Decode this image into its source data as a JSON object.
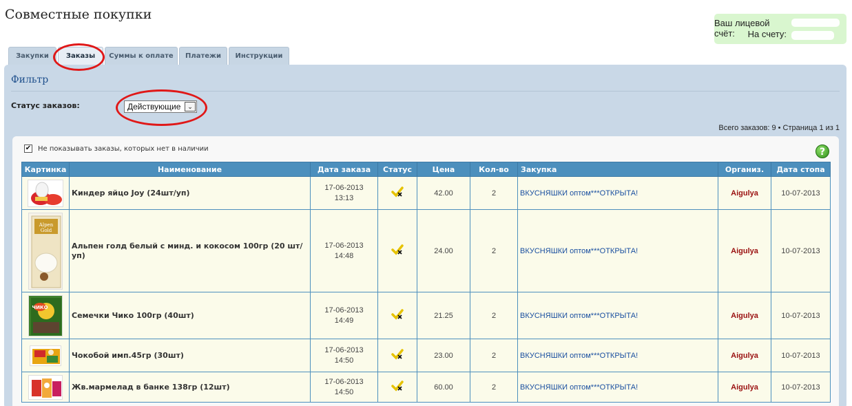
{
  "page": {
    "title": "Совместные покупки"
  },
  "account": {
    "line1": "Ваш лицевой счёт:",
    "line2": "На счету:"
  },
  "tabs": [
    {
      "label": "Закупки",
      "active": false
    },
    {
      "label": "Заказы",
      "active": true
    },
    {
      "label": "Суммы к оплате",
      "active": false
    },
    {
      "label": "Платежи",
      "active": false
    },
    {
      "label": "Инструкции",
      "active": false
    }
  ],
  "filter": {
    "title": "Фильтр",
    "status_label": "Статус заказов:",
    "status_value": "Действующие",
    "totals": "Всего заказов: 9 • Страница 1 из 1"
  },
  "options": {
    "hide_unavailable_label": "Не показывать заказы, которых нет в наличии",
    "hide_unavailable_checked": true
  },
  "help": {
    "icon": "help-icon",
    "symbol": "?"
  },
  "colors": {
    "header_blue": "#4c8fbd",
    "panel_bg": "#c9d8e7",
    "row_bg": "#fbfbea",
    "org_red": "#9a1010",
    "link_blue": "#1a4fa0",
    "annotation_red": "#e01818"
  },
  "table": {
    "columns": [
      "Картинка",
      "Наименование",
      "Дата заказа",
      "Статус",
      "Цена",
      "Кол-во",
      "Закупка",
      "Организ.",
      "Дата стопа"
    ],
    "rows": [
      {
        "image": "kinder-joy-thumbnail",
        "name": "Киндер яйцо Joy (24шт/уп)",
        "date": "17-06-2013",
        "time": "13:13",
        "status_icon": "check-x-icon",
        "price": "42.00",
        "qty": "2",
        "purchase": "ВКУСНЯШКИ оптом***ОТКРЫТА!",
        "org": "Aigulya",
        "stop": "10-07-2013"
      },
      {
        "image": "alpen-gold-thumbnail",
        "name": "Альпен голд белый с минд. и кокосом 100гр (20 шт/уп)",
        "date": "17-06-2013",
        "time": "14:48",
        "status_icon": "check-x-icon",
        "price": "24.00",
        "qty": "2",
        "purchase": "ВКУСНЯШКИ оптом***ОТКРЫТА!",
        "org": "Aigulya",
        "stop": "10-07-2013"
      },
      {
        "image": "chiko-seeds-thumbnail",
        "name": "Семечки Чико 100гр (40шт)",
        "date": "17-06-2013",
        "time": "14:49",
        "status_icon": "check-x-icon",
        "price": "21.25",
        "qty": "2",
        "purchase": "ВКУСНЯШКИ оптом***ОТКРЫТА!",
        "org": "Aigulya",
        "stop": "10-07-2013"
      },
      {
        "image": "chokoboy-thumbnail",
        "name": "Чокобой имп.45гр (30шт)",
        "date": "17-06-2013",
        "time": "14:50",
        "status_icon": "check-x-icon",
        "price": "23.00",
        "qty": "2",
        "purchase": "ВКУСНЯШКИ оптом***ОТКРЫТА!",
        "org": "Aigulya",
        "stop": "10-07-2013"
      },
      {
        "image": "marmalade-thumbnail",
        "name": "Жв.мармелад в банке 138гр (12шт)",
        "date": "17-06-2013",
        "time": "14:50",
        "status_icon": "check-x-icon",
        "price": "60.00",
        "qty": "2",
        "purchase": "ВКУСНЯШКИ оптом***ОТКРЫТА!",
        "org": "Aigulya",
        "stop": "10-07-2013"
      }
    ]
  }
}
